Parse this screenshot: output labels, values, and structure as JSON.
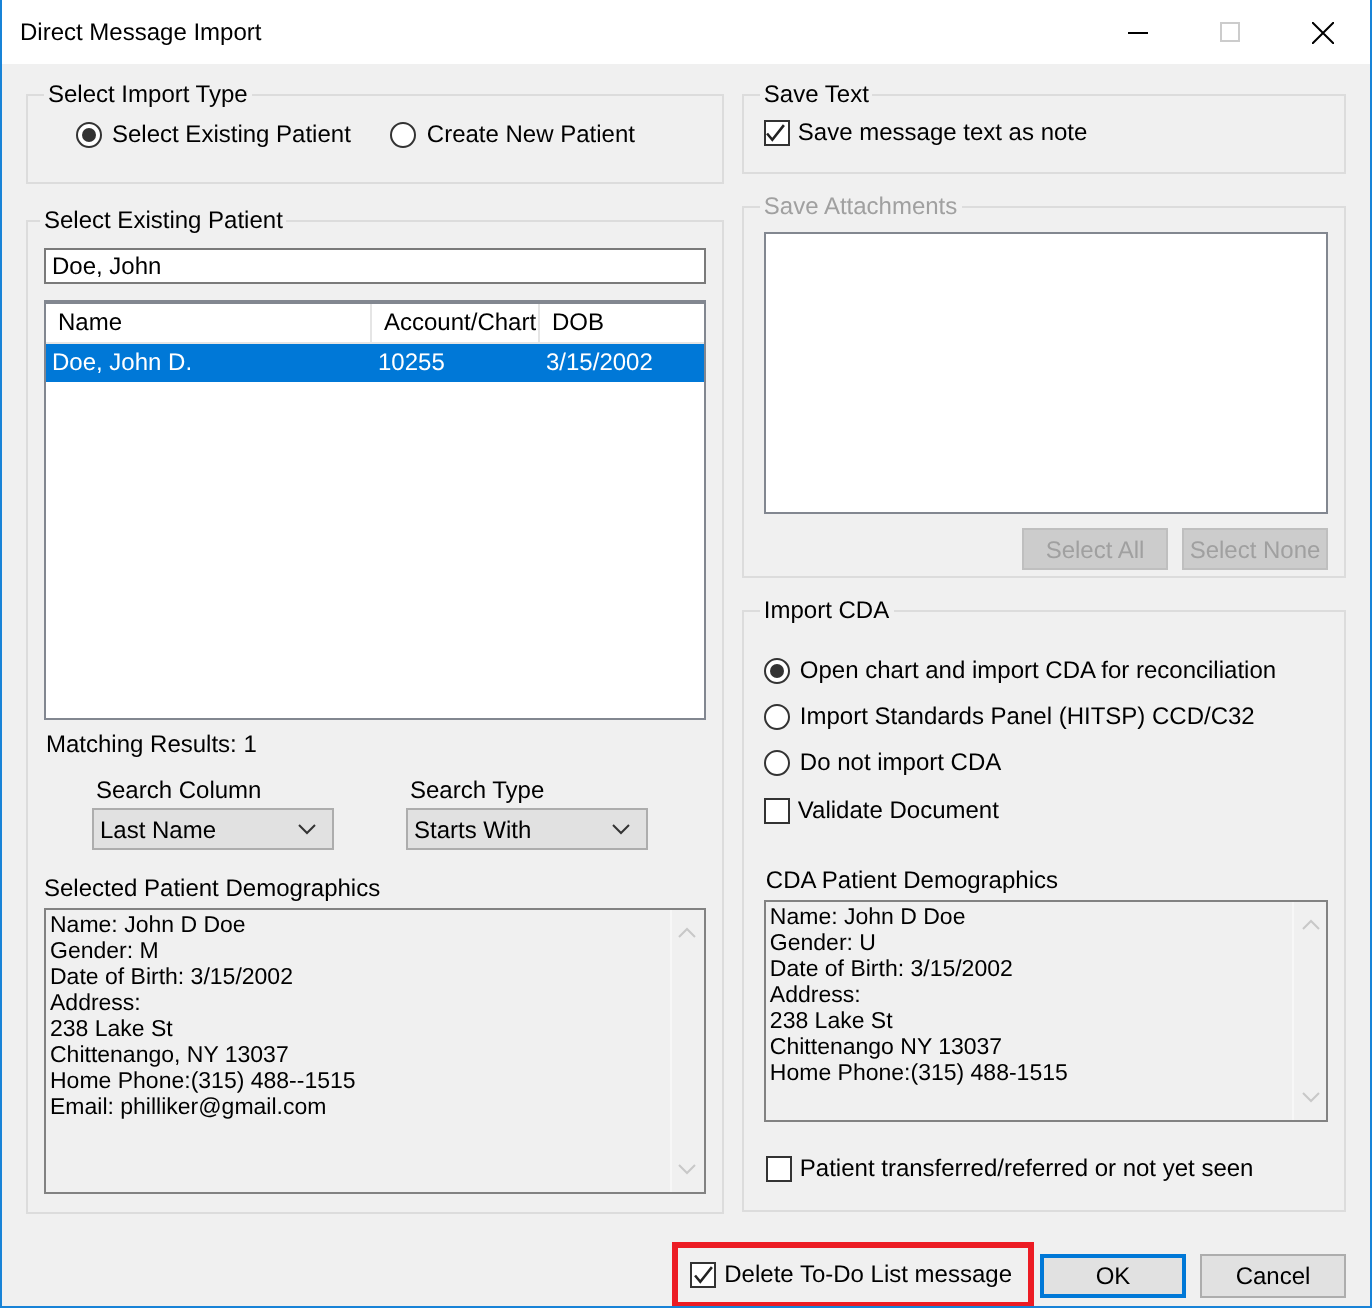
{
  "window": {
    "title": "Direct Message Import"
  },
  "import_type": {
    "label": "Select Import Type",
    "options": [
      {
        "label": "Select Existing Patient",
        "selected": true
      },
      {
        "label": "Create New Patient",
        "selected": false
      }
    ]
  },
  "existing_patient": {
    "label": "Select Existing Patient",
    "search": {
      "value": "Doe, John"
    },
    "table": {
      "columns": [
        "Name",
        "Account/Chart",
        "DOB"
      ],
      "rows": [
        {
          "cells": [
            "Doe, John D.",
            "10255",
            "3/15/2002"
          ],
          "selected": true
        }
      ]
    },
    "matching_results": "Matching Results: 1",
    "search_column": {
      "label": "Search Column",
      "value": "Last Name"
    },
    "search_type": {
      "label": "Search Type",
      "value": "Starts With"
    },
    "demographics": {
      "label": "Selected Patient Demographics",
      "text": "Name: John D Doe\nGender: M\nDate of Birth: 3/15/2002\nAddress:\n238 Lake St\nChittenango, NY 13037\nHome Phone:(315) 488--1515\nEmail: philliker@gmail.com"
    }
  },
  "save_text": {
    "label": "Save Text",
    "checkbox": {
      "label": "Save message text as note",
      "checked": true
    }
  },
  "save_attachments": {
    "label": "Save Attachments",
    "disabled": true,
    "buttons": [
      {
        "label": "Select All",
        "disabled": true
      },
      {
        "label": "Select None",
        "disabled": true
      }
    ]
  },
  "import_cda": {
    "label": "Import CDA",
    "options": [
      {
        "label": "Open chart and import CDA for reconciliation",
        "selected": true
      },
      {
        "label": "Import Standards Panel (HITSP) CCD/C32",
        "selected": false
      },
      {
        "label": "Do not import CDA",
        "selected": false
      }
    ],
    "validate": {
      "label": "Validate Document",
      "checked": false
    },
    "demographics": {
      "label": "CDA Patient Demographics",
      "text": "Name: John D Doe\nGender: U\nDate of Birth: 3/15/2002\nAddress:\n238 Lake St\nChittenango NY 13037\nHome Phone:(315) 488-1515"
    },
    "transferred": {
      "label": "Patient transferred/referred or not yet seen",
      "checked": false
    }
  },
  "footer": {
    "delete_todo": {
      "label": "Delete To-Do List message",
      "checked": true,
      "highlighted": true
    },
    "buttons": [
      {
        "label": "OK",
        "default": true
      },
      {
        "label": "Cancel",
        "default": false
      }
    ]
  }
}
